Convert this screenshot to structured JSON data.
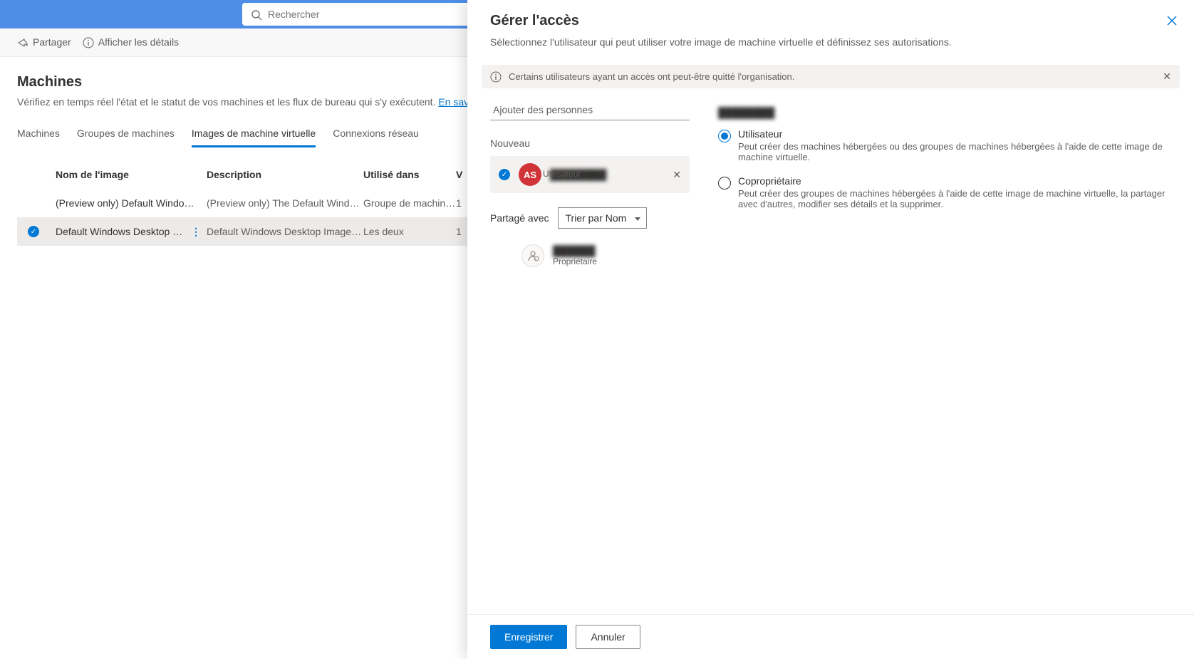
{
  "search": {
    "placeholder": "Rechercher"
  },
  "toolbar": {
    "share": "Partager",
    "details": "Afficher les détails"
  },
  "page": {
    "title": "Machines",
    "desc": "Vérifiez en temps réel l'état et le statut de vos machines et les flux de bureau qui s'y exécutent. ",
    "learn_more": "En savoir plus"
  },
  "tabs": {
    "machines": "Machines",
    "groups": "Groupes de machines",
    "images": "Images de machine virtuelle",
    "connections": "Connexions réseau"
  },
  "table": {
    "headers": {
      "name": "Nom de l'image",
      "desc": "Description",
      "used": "Utilisé dans",
      "v": "V"
    },
    "rows": [
      {
        "selected": false,
        "name": "(Preview only) Default Windo…",
        "desc": "(Preview only) The Default Windows Desk…",
        "used": "Groupe de machines h…",
        "v": "1"
      },
      {
        "selected": true,
        "name": "Default Windows Desktop I…",
        "desc": "Default Windows Desktop Image for use i…",
        "used": "Les deux",
        "v": "1"
      }
    ]
  },
  "panel": {
    "title": "Gérer l'accès",
    "subtitle": "Sélectionnez l'utilisateur qui peut utiliser votre image de machine virtuelle et définissez ses autorisations.",
    "info": "Certains utilisateurs ayant un accès ont peut-être quitté l'organisation.",
    "add_placeholder": "Ajouter des personnes",
    "new_label": "Nouveau",
    "new_user": {
      "initials": "AS",
      "role": "Utilisateur"
    },
    "shared_label": "Partagé avec",
    "sort": "Trier par Nom",
    "owner": {
      "role": "Propriétaire"
    },
    "perm_user": {
      "label": "Utilisateur",
      "desc": "Peut créer des machines hébergées ou des groupes de machines hébergées à l'aide de cette image de machine virtuelle."
    },
    "perm_coowner": {
      "label": "Copropriétaire",
      "desc": "Peut créer des groupes de machines hébergées à l'aide de cette image de machine virtuelle, la partager avec d'autres, modifier ses détails et la supprimer."
    },
    "save": "Enregistrer",
    "cancel": "Annuler"
  }
}
